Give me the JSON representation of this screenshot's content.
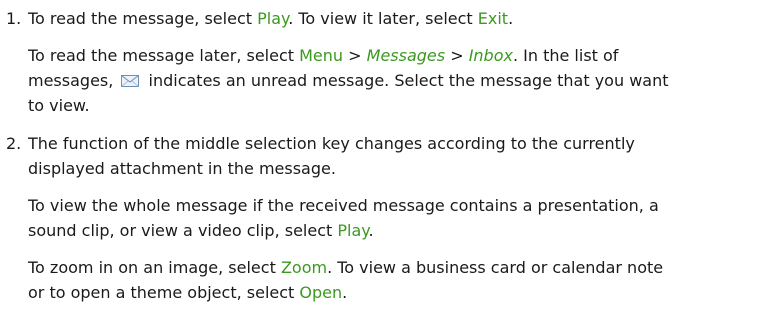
{
  "item1": {
    "number": "1.",
    "p1": {
      "a": "To read the message, select ",
      "key_play": "Play",
      "b": ". To view it later, select ",
      "key_exit": "Exit",
      "c": "."
    },
    "p2": {
      "a": "To read the message later, select ",
      "key_menu": "Menu",
      "sep1": " > ",
      "key_messages": "Messages",
      "sep2": " > ",
      "key_inbox": "Inbox",
      "b": ". In the list of",
      "c": "messages, ",
      "icon": "unread-message-envelope-icon",
      "d": " indicates an unread message. Select the message that you want",
      "e": "to view."
    }
  },
  "item2": {
    "number": "2.",
    "p1": {
      "line1": "The function of the middle selection key changes according to the currently",
      "line2": "displayed attachment in the message."
    },
    "p2": {
      "line1": "To view the whole message if the received message contains a presentation, a",
      "a": "sound clip, or view a video clip, select ",
      "key_play": "Play",
      "b": "."
    },
    "p3": {
      "a": "To zoom in on an image, select ",
      "key_zoom": "Zoom",
      "b": ". To view a business card or calendar note",
      "c": "or to open a theme object, select ",
      "key_open": "Open",
      "d": "."
    }
  },
  "colors": {
    "key_text": "#3a9a1f",
    "body_text": "#1a1a1a"
  }
}
